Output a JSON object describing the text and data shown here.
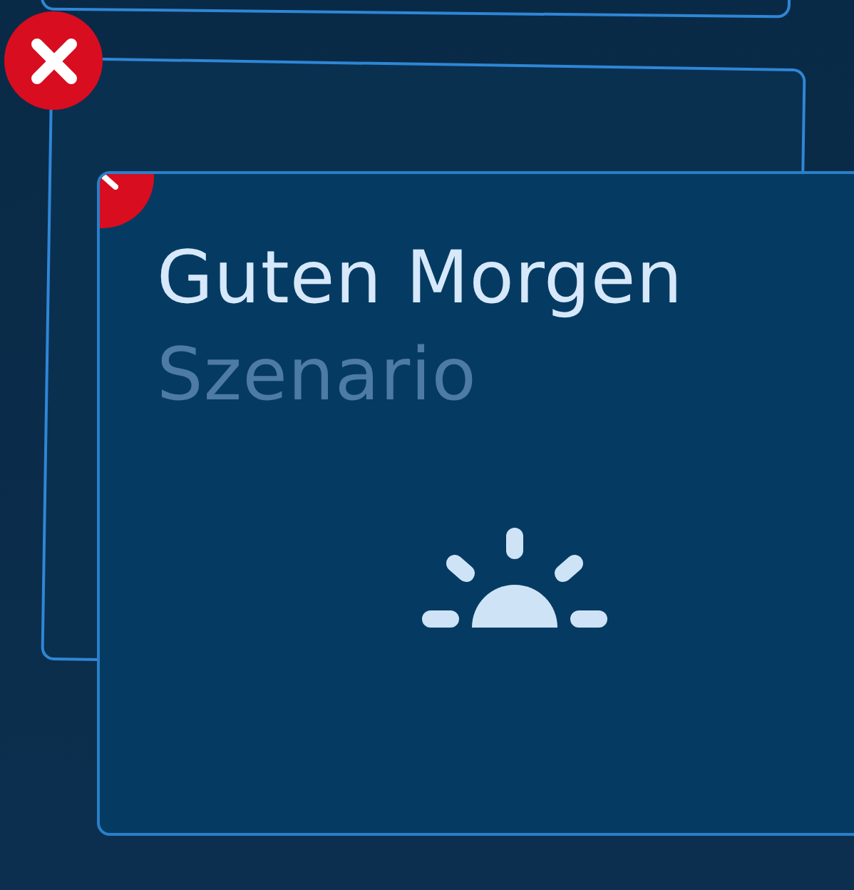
{
  "edit_mode": true,
  "tiles": [
    {
      "title": "Guten Morgen",
      "subtitle": "Szenario",
      "kind": "scene"
    }
  ]
}
